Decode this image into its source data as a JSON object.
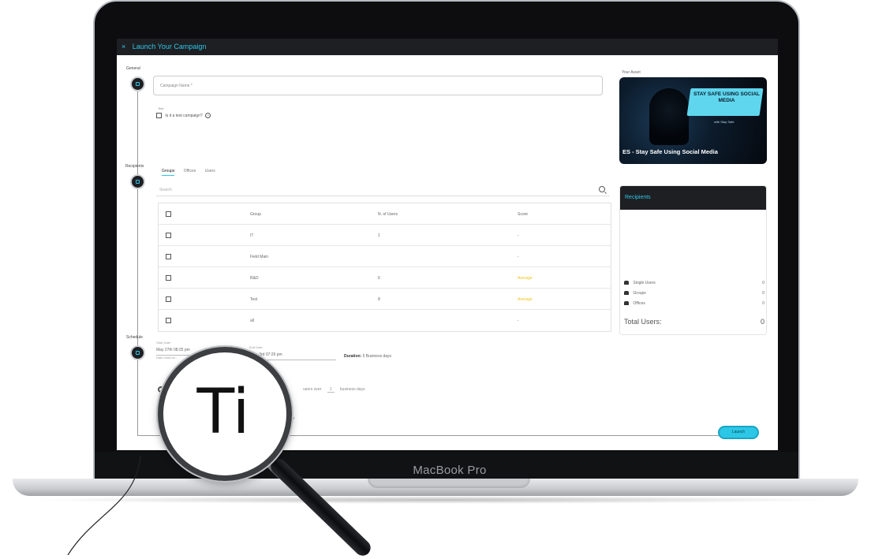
{
  "device": {
    "model": "MacBook Pro"
  },
  "app": {
    "title": "Launch Your Campaign",
    "close_glyph": "×"
  },
  "steps": {
    "general": "General",
    "recipients": "Recipients",
    "schedule": "Schedule"
  },
  "general": {
    "name_placeholder": "Campaign Name *",
    "test_section": "Test",
    "test_checkbox_label": "Is it a test campaign?",
    "help_glyph": "?"
  },
  "recipients": {
    "tabs": [
      "Groups",
      "Offices",
      "Users"
    ],
    "search_placeholder": "Search",
    "columns": [
      "Group",
      "N. of Users",
      "Score"
    ],
    "rows": [
      {
        "group": "IT",
        "users": "1",
        "score": "-"
      },
      {
        "group": "Field Main",
        "users": "",
        "score": "-"
      },
      {
        "group": "R&D",
        "users": "6",
        "score": "Average"
      },
      {
        "group": "Test",
        "users": "8",
        "score": "Average"
      },
      {
        "group": "all",
        "users": "",
        "score": "-"
      }
    ]
  },
  "schedule": {
    "start_label": "Start Date",
    "start_value": "May 27th 08:25 pm",
    "start_note": "Date must be...",
    "end_label": "End Date",
    "end_value": "June 3rd 07:26 pm",
    "duration_label": "Duration:",
    "duration_value": "5 Business days",
    "business_text": "users over",
    "business_num": "1",
    "business_suffix": "business days",
    "language_text": "language"
  },
  "asset": {
    "label": "Your Asset",
    "banner": "STAY SAFE USING SOCIAL MEDIA",
    "subtag": "with Stay Safe",
    "caption": "ES - Stay Safe Using Social Media"
  },
  "recipients_card": {
    "title": "Recipients",
    "single_users_label": "Single Users",
    "single_users_value": "0",
    "groups_label": "Groups",
    "groups_value": "0",
    "offices_label": "Offices",
    "offices_value": "0",
    "total_label": "Total Users:",
    "total_value": "0"
  },
  "launch_button": "Launch",
  "magnifier": {
    "text": "Ti"
  },
  "colors": {
    "accent": "#2cc7e6",
    "dark": "#1e1f23",
    "warning": "#f0c419"
  }
}
